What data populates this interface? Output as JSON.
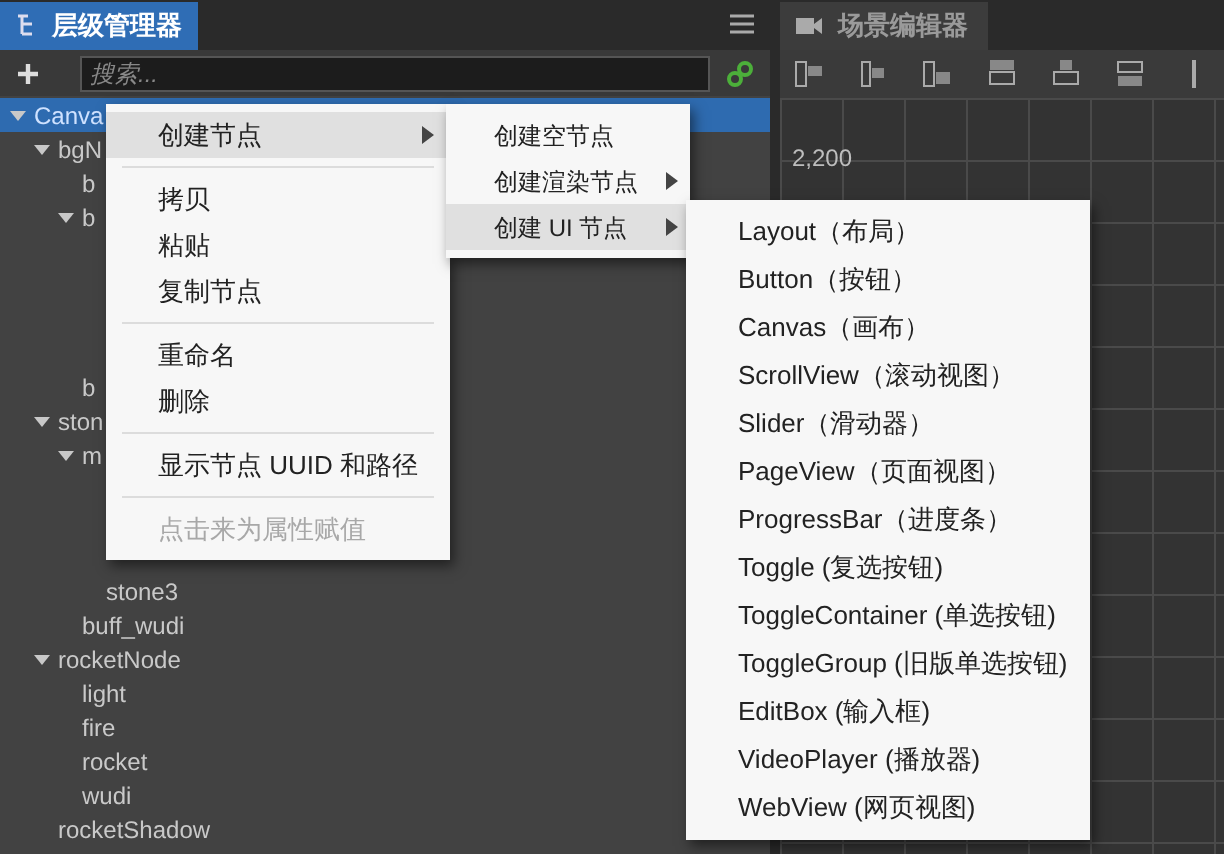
{
  "hierarchy": {
    "tab": {
      "label": "层级管理器",
      "selected": true
    },
    "search": {
      "placeholder": "搜索..."
    },
    "tree": [
      {
        "label": "Canva",
        "expanded": true,
        "selected": true,
        "children": [
          {
            "label": "bgN",
            "expanded": true,
            "selected": false,
            "children": [
              {
                "label": "b",
                "selected": false
              },
              {
                "label": "b",
                "expanded": true,
                "selected": false
              },
              {
                "label": "b",
                "selected": false
              }
            ]
          },
          {
            "label": "ston",
            "expanded": true,
            "selected": false,
            "children": [
              {
                "label": "m",
                "expanded": true,
                "selected": false,
                "children": [
                  {
                    "label": "stone3",
                    "selected": false
                  }
                ]
              },
              {
                "label": "buff_wudi",
                "selected": false
              }
            ]
          },
          {
            "label": "rocketNode",
            "expanded": true,
            "selected": false,
            "children": [
              {
                "label": "light",
                "selected": false
              },
              {
                "label": "fire",
                "selected": false
              },
              {
                "label": "rocket",
                "selected": false
              },
              {
                "label": "wudi",
                "selected": false
              }
            ]
          },
          {
            "label": "rocketShadow",
            "selected": false
          }
        ]
      }
    ]
  },
  "scene_editor": {
    "tab": {
      "label": "场景编辑器",
      "selected": false
    },
    "axis_label": "2,200"
  },
  "context_menus": [
    {
      "items": [
        {
          "kind": "item",
          "label": "创建节点",
          "submenu": true,
          "selected": true,
          "disabled": false
        },
        {
          "kind": "separator"
        },
        {
          "kind": "item",
          "label": "拷贝",
          "submenu": false,
          "selected": false,
          "disabled": false
        },
        {
          "kind": "item",
          "label": "粘贴",
          "submenu": false,
          "selected": false,
          "disabled": false
        },
        {
          "kind": "item",
          "label": "复制节点",
          "submenu": false,
          "selected": false,
          "disabled": false
        },
        {
          "kind": "separator"
        },
        {
          "kind": "item",
          "label": "重命名",
          "submenu": false,
          "selected": false,
          "disabled": false
        },
        {
          "kind": "item",
          "label": "删除",
          "submenu": false,
          "selected": false,
          "disabled": false
        },
        {
          "kind": "separator"
        },
        {
          "kind": "item",
          "label": "显示节点 UUID 和路径",
          "submenu": false,
          "selected": false,
          "disabled": false
        },
        {
          "kind": "separator"
        },
        {
          "kind": "item",
          "label": "点击来为属性赋值",
          "submenu": false,
          "selected": false,
          "disabled": true
        }
      ]
    },
    {
      "items": [
        {
          "kind": "item",
          "label": "创建空节点",
          "submenu": false,
          "selected": false,
          "disabled": false
        },
        {
          "kind": "item",
          "label": "创建渲染节点",
          "submenu": true,
          "selected": false,
          "disabled": false
        },
        {
          "kind": "item",
          "label": "创建 UI 节点",
          "submenu": true,
          "selected": true,
          "disabled": false
        }
      ]
    },
    {
      "items": [
        {
          "kind": "item",
          "label": "Layout（布局）",
          "submenu": false,
          "selected": false,
          "disabled": false
        },
        {
          "kind": "item",
          "label": "Button（按钮）",
          "submenu": false,
          "selected": false,
          "disabled": false
        },
        {
          "kind": "item",
          "label": "Canvas（画布）",
          "submenu": false,
          "selected": false,
          "disabled": false
        },
        {
          "kind": "item",
          "label": "ScrollView（滚动视图）",
          "submenu": false,
          "selected": false,
          "disabled": false
        },
        {
          "kind": "item",
          "label": "Slider（滑动器）",
          "submenu": false,
          "selected": false,
          "disabled": false
        },
        {
          "kind": "item",
          "label": "PageView（页面视图）",
          "submenu": false,
          "selected": false,
          "disabled": false
        },
        {
          "kind": "item",
          "label": "ProgressBar（进度条）",
          "submenu": false,
          "selected": false,
          "disabled": false
        },
        {
          "kind": "item",
          "label": "Toggle (复选按钮)",
          "submenu": false,
          "selected": false,
          "disabled": false
        },
        {
          "kind": "item",
          "label": "ToggleContainer (单选按钮)",
          "submenu": false,
          "selected": false,
          "disabled": false
        },
        {
          "kind": "item",
          "label": "ToggleGroup (旧版单选按钮)",
          "submenu": false,
          "selected": false,
          "disabled": false
        },
        {
          "kind": "item",
          "label": "EditBox (输入框)",
          "submenu": false,
          "selected": false,
          "disabled": false
        },
        {
          "kind": "item",
          "label": "VideoPlayer (播放器)",
          "submenu": false,
          "selected": false,
          "disabled": false
        },
        {
          "kind": "item",
          "label": "WebView (网页视图)",
          "submenu": false,
          "selected": false,
          "disabled": false
        }
      ]
    }
  ]
}
